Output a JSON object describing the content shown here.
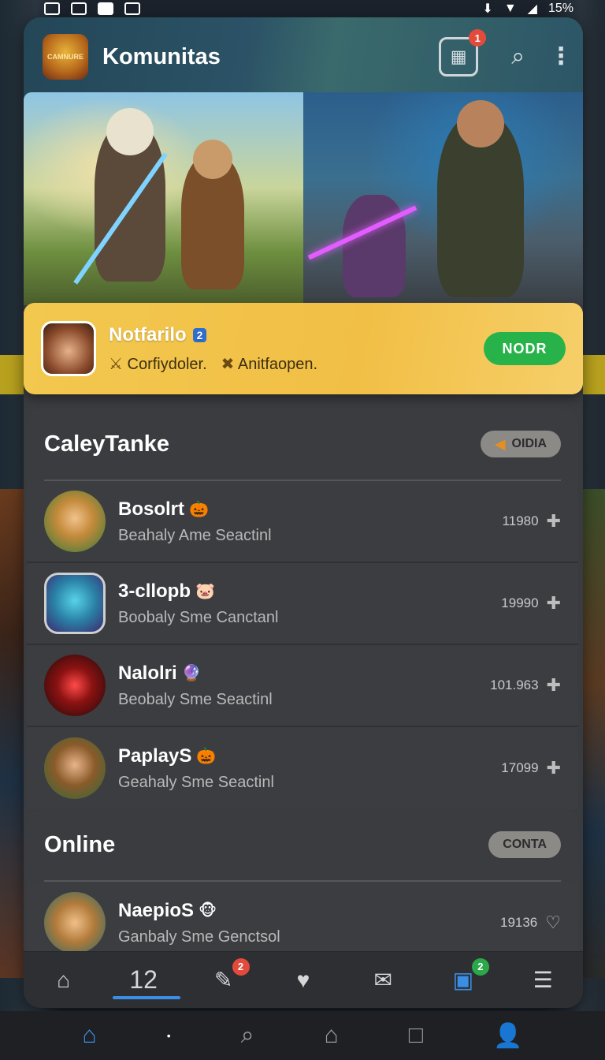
{
  "status_bar": {
    "battery": "15%"
  },
  "header": {
    "logo_text": "CAMNURE",
    "title": "Komunitas",
    "notif_badge": "1"
  },
  "featured": {
    "name": "Notfarilo",
    "level_badge": "2",
    "tag1": "Corfiydoler.",
    "tag2": "Anitfaopen.",
    "button": "NODR"
  },
  "section1": {
    "title": "CaleyTanke",
    "pill": "OIDIA",
    "items": [
      {
        "name": "Bosolrt",
        "emoji": "🎃",
        "sub": "Beahaly  Ame  Seactinl",
        "count": "11980"
      },
      {
        "name": "3-cllopb",
        "emoji": "🐷",
        "sub": "Boobaly  Sme  Canctanl",
        "count": "19990"
      },
      {
        "name": "Nalolri",
        "emoji": "🔮",
        "sub": "Beobaly  Sme  Seactinl",
        "count": "101.963"
      },
      {
        "name": "PaplayS",
        "emoji": "🎃",
        "sub": "Geahaly  Sme  Seactinl",
        "count": "17099"
      }
    ]
  },
  "section2": {
    "title": "Online",
    "pill": "CONTA",
    "items": [
      {
        "name": "NaepioS",
        "emoji": "🐵",
        "sub": "Ganbaly  Sme  Genctsol",
        "count": "19136"
      }
    ]
  },
  "tabbar": {
    "count_label": "12",
    "badge_chat": "2",
    "badge_board": "2"
  },
  "colors": {
    "accent": "#3a8ee6",
    "feature_bg": "#f3c84f",
    "button_green": "#27b34a",
    "badge_red": "#e24b3b"
  }
}
